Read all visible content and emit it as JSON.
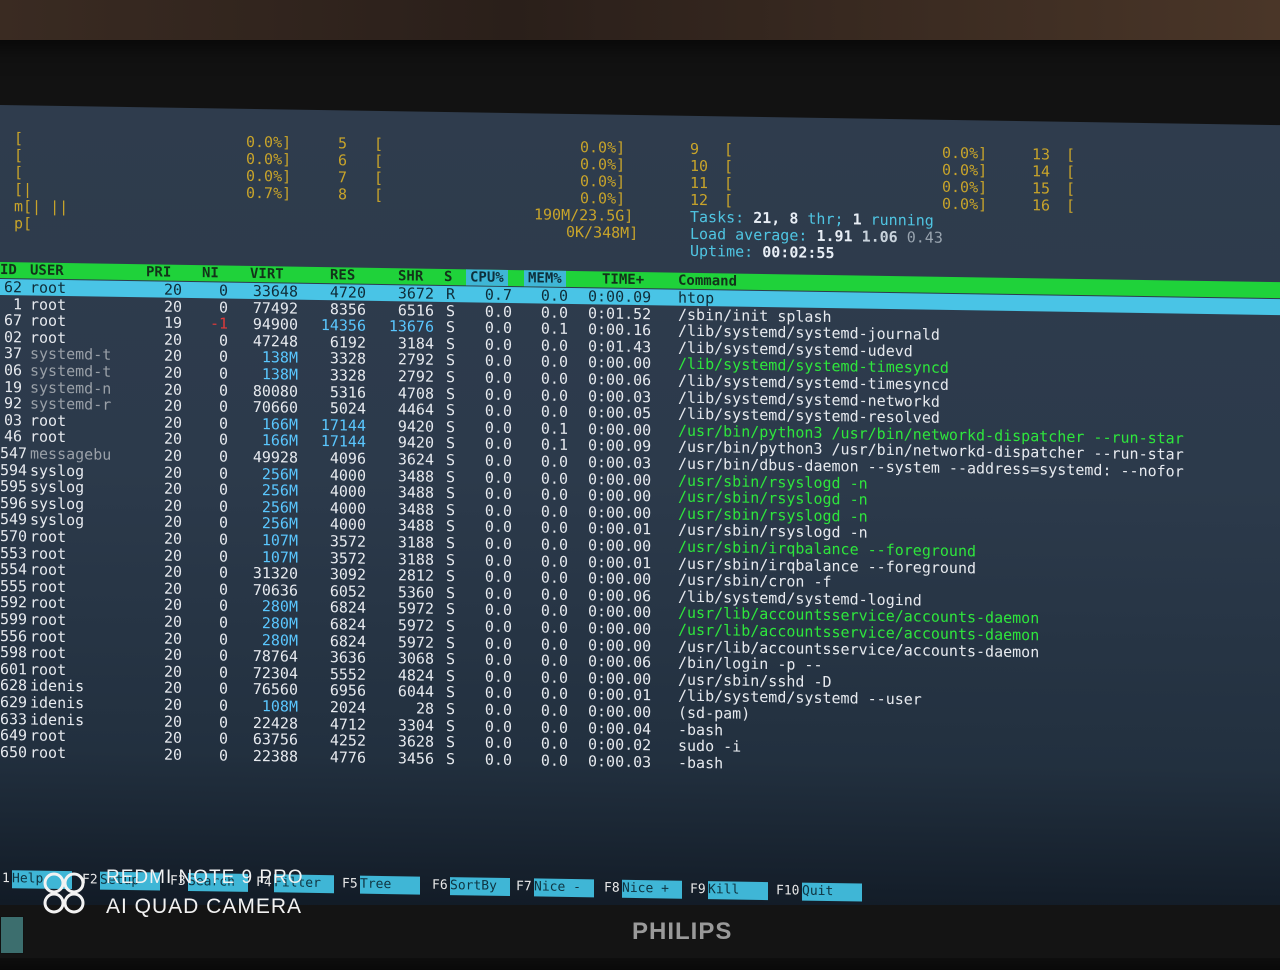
{
  "watermark": {
    "line1": "REDMI NOTE 9 PRO",
    "line2": "AI QUAD CAMERA"
  },
  "monitor_brand": "PHILIPS",
  "meters": {
    "col1": [
      "[",
      "[",
      "[",
      "[|",
      "m[| ||",
      "p["
    ],
    "col2": [
      "0.0%]",
      "0.0%]",
      "0.0%]",
      "0.7%]"
    ],
    "col3": [
      "5",
      "6",
      "7",
      "8"
    ],
    "col3b": [
      "[",
      "[",
      "[",
      "["
    ],
    "col4": [
      "0.0%]",
      "0.0%]",
      "0.0%]",
      "0.0%]",
      "190M/23.5G]",
      "0K/348M]"
    ],
    "col5": [
      "9",
      "10",
      "11",
      "12"
    ],
    "col5b": [
      "[",
      "[",
      "[",
      "["
    ],
    "col6": [
      "0.0%]",
      "0.0%]",
      "0.0%]",
      "0.0%]"
    ],
    "col7": [
      "13",
      "14",
      "15",
      "16"
    ],
    "col7b": [
      "[",
      "[",
      "[",
      "["
    ]
  },
  "stats": {
    "tasks_label": "Tasks:",
    "tasks_value": "21,",
    "thr_value": "8",
    "thr_label": "thr;",
    "running_value": "1",
    "running_label": "running",
    "load_label": "Load average:",
    "load1": "1.91",
    "load5": "1.06",
    "load15": "0.43",
    "uptime_label": "Uptime:",
    "uptime_value": "00:02:55"
  },
  "columns": [
    "ID",
    "USER",
    "PRI",
    "NI",
    "VIRT",
    "RES",
    "SHR",
    "S",
    "CPU%",
    "MEM%",
    "TIME+",
    "Command"
  ],
  "processes": [
    {
      "pid": "62",
      "user": "root",
      "pri": "20",
      "ni": "0",
      "virt": "33648",
      "res": "4720",
      "shr": "3672",
      "s": "R",
      "cpu": "0.7",
      "mem": "0.0",
      "time": "0:00.09",
      "cmd": "htop",
      "cmdc": "plain"
    },
    {
      "pid": "1",
      "user": "root",
      "pri": "20",
      "ni": "0",
      "virt": "77492",
      "res": "8356",
      "shr": "6516",
      "s": "S",
      "cpu": "0.0",
      "mem": "0.0",
      "time": "0:01.52",
      "cmd": "/sbin/init splash",
      "cmdc": "plain"
    },
    {
      "pid": "67",
      "user": "root",
      "pri": "19",
      "ni": "-1",
      "virt": "94900",
      "res": "14356",
      "shr": "13676",
      "s": "S",
      "cpu": "0.0",
      "mem": "0.1",
      "time": "0:00.16",
      "cmd": "/lib/systemd/systemd-journald",
      "cmdc": "plain"
    },
    {
      "pid": "02",
      "user": "root",
      "pri": "20",
      "ni": "0",
      "virt": "47248",
      "res": "6192",
      "shr": "3184",
      "s": "S",
      "cpu": "0.0",
      "mem": "0.0",
      "time": "0:01.43",
      "cmd": "/lib/systemd/systemd-udevd",
      "cmdc": "plain"
    },
    {
      "pid": "37",
      "user": "systemd-t",
      "pri": "20",
      "ni": "0",
      "virt": "138M",
      "res": "3328",
      "shr": "2792",
      "s": "S",
      "cpu": "0.0",
      "mem": "0.0",
      "time": "0:00.00",
      "cmd": "/lib/systemd/systemd-timesyncd",
      "cmdc": "green"
    },
    {
      "pid": "06",
      "user": "systemd-t",
      "pri": "20",
      "ni": "0",
      "virt": "138M",
      "res": "3328",
      "shr": "2792",
      "s": "S",
      "cpu": "0.0",
      "mem": "0.0",
      "time": "0:00.06",
      "cmd": "/lib/systemd/systemd-timesyncd",
      "cmdc": "plain"
    },
    {
      "pid": "19",
      "user": "systemd-n",
      "pri": "20",
      "ni": "0",
      "virt": "80080",
      "res": "5316",
      "shr": "4708",
      "s": "S",
      "cpu": "0.0",
      "mem": "0.0",
      "time": "0:00.03",
      "cmd": "/lib/systemd/systemd-networkd",
      "cmdc": "plain"
    },
    {
      "pid": "92",
      "user": "systemd-r",
      "pri": "20",
      "ni": "0",
      "virt": "70660",
      "res": "5024",
      "shr": "4464",
      "s": "S",
      "cpu": "0.0",
      "mem": "0.0",
      "time": "0:00.05",
      "cmd": "/lib/systemd/systemd-resolved",
      "cmdc": "plain"
    },
    {
      "pid": "03",
      "user": "root",
      "pri": "20",
      "ni": "0",
      "virt": "166M",
      "res": "17144",
      "shr": "9420",
      "s": "S",
      "cpu": "0.0",
      "mem": "0.1",
      "time": "0:00.00",
      "cmd": "/usr/bin/python3 /usr/bin/networkd-dispatcher --run-star",
      "cmdc": "green"
    },
    {
      "pid": "46",
      "user": "root",
      "pri": "20",
      "ni": "0",
      "virt": "166M",
      "res": "17144",
      "shr": "9420",
      "s": "S",
      "cpu": "0.0",
      "mem": "0.1",
      "time": "0:00.09",
      "cmd": "/usr/bin/python3 /usr/bin/networkd-dispatcher --run-star",
      "cmdc": "plain"
    },
    {
      "pid": "547",
      "user": "messagebu",
      "pri": "20",
      "ni": "0",
      "virt": "49928",
      "res": "4096",
      "shr": "3624",
      "s": "S",
      "cpu": "0.0",
      "mem": "0.0",
      "time": "0:00.03",
      "cmd": "/usr/bin/dbus-daemon --system --address=systemd: --nofor",
      "cmdc": "plain"
    },
    {
      "pid": "594",
      "user": "syslog",
      "pri": "20",
      "ni": "0",
      "virt": "256M",
      "res": "4000",
      "shr": "3488",
      "s": "S",
      "cpu": "0.0",
      "mem": "0.0",
      "time": "0:00.00",
      "cmd": "/usr/sbin/rsyslogd -n",
      "cmdc": "green"
    },
    {
      "pid": "595",
      "user": "syslog",
      "pri": "20",
      "ni": "0",
      "virt": "256M",
      "res": "4000",
      "shr": "3488",
      "s": "S",
      "cpu": "0.0",
      "mem": "0.0",
      "time": "0:00.00",
      "cmd": "/usr/sbin/rsyslogd -n",
      "cmdc": "green"
    },
    {
      "pid": "596",
      "user": "syslog",
      "pri": "20",
      "ni": "0",
      "virt": "256M",
      "res": "4000",
      "shr": "3488",
      "s": "S",
      "cpu": "0.0",
      "mem": "0.0",
      "time": "0:00.00",
      "cmd": "/usr/sbin/rsyslogd -n",
      "cmdc": "green"
    },
    {
      "pid": "549",
      "user": "syslog",
      "pri": "20",
      "ni": "0",
      "virt": "256M",
      "res": "4000",
      "shr": "3488",
      "s": "S",
      "cpu": "0.0",
      "mem": "0.0",
      "time": "0:00.01",
      "cmd": "/usr/sbin/rsyslogd -n",
      "cmdc": "plain"
    },
    {
      "pid": "570",
      "user": "root",
      "pri": "20",
      "ni": "0",
      "virt": "107M",
      "res": "3572",
      "shr": "3188",
      "s": "S",
      "cpu": "0.0",
      "mem": "0.0",
      "time": "0:00.00",
      "cmd": "/usr/sbin/irqbalance --foreground",
      "cmdc": "green"
    },
    {
      "pid": "553",
      "user": "root",
      "pri": "20",
      "ni": "0",
      "virt": "107M",
      "res": "3572",
      "shr": "3188",
      "s": "S",
      "cpu": "0.0",
      "mem": "0.0",
      "time": "0:00.01",
      "cmd": "/usr/sbin/irqbalance --foreground",
      "cmdc": "plain"
    },
    {
      "pid": "554",
      "user": "root",
      "pri": "20",
      "ni": "0",
      "virt": "31320",
      "res": "3092",
      "shr": "2812",
      "s": "S",
      "cpu": "0.0",
      "mem": "0.0",
      "time": "0:00.00",
      "cmd": "/usr/sbin/cron -f",
      "cmdc": "plain"
    },
    {
      "pid": "555",
      "user": "root",
      "pri": "20",
      "ni": "0",
      "virt": "70636",
      "res": "6052",
      "shr": "5360",
      "s": "S",
      "cpu": "0.0",
      "mem": "0.0",
      "time": "0:00.06",
      "cmd": "/lib/systemd/systemd-logind",
      "cmdc": "plain"
    },
    {
      "pid": "592",
      "user": "root",
      "pri": "20",
      "ni": "0",
      "virt": "280M",
      "res": "6824",
      "shr": "5972",
      "s": "S",
      "cpu": "0.0",
      "mem": "0.0",
      "time": "0:00.00",
      "cmd": "/usr/lib/accountsservice/accounts-daemon",
      "cmdc": "green"
    },
    {
      "pid": "599",
      "user": "root",
      "pri": "20",
      "ni": "0",
      "virt": "280M",
      "res": "6824",
      "shr": "5972",
      "s": "S",
      "cpu": "0.0",
      "mem": "0.0",
      "time": "0:00.00",
      "cmd": "/usr/lib/accountsservice/accounts-daemon",
      "cmdc": "green"
    },
    {
      "pid": "556",
      "user": "root",
      "pri": "20",
      "ni": "0",
      "virt": "280M",
      "res": "6824",
      "shr": "5972",
      "s": "S",
      "cpu": "0.0",
      "mem": "0.0",
      "time": "0:00.00",
      "cmd": "/usr/lib/accountsservice/accounts-daemon",
      "cmdc": "plain"
    },
    {
      "pid": "598",
      "user": "root",
      "pri": "20",
      "ni": "0",
      "virt": "78764",
      "res": "3636",
      "shr": "3068",
      "s": "S",
      "cpu": "0.0",
      "mem": "0.0",
      "time": "0:00.06",
      "cmd": "/bin/login -p --",
      "cmdc": "plain"
    },
    {
      "pid": "601",
      "user": "root",
      "pri": "20",
      "ni": "0",
      "virt": "72304",
      "res": "5552",
      "shr": "4824",
      "s": "S",
      "cpu": "0.0",
      "mem": "0.0",
      "time": "0:00.00",
      "cmd": "/usr/sbin/sshd -D",
      "cmdc": "plain"
    },
    {
      "pid": "628",
      "user": "idenis",
      "pri": "20",
      "ni": "0",
      "virt": "76560",
      "res": "6956",
      "shr": "6044",
      "s": "S",
      "cpu": "0.0",
      "mem": "0.0",
      "time": "0:00.01",
      "cmd": "/lib/systemd/systemd --user",
      "cmdc": "plain"
    },
    {
      "pid": "629",
      "user": "idenis",
      "pri": "20",
      "ni": "0",
      "virt": "108M",
      "res": "2024",
      "shr": "28",
      "s": "S",
      "cpu": "0.0",
      "mem": "0.0",
      "time": "0:00.00",
      "cmd": "(sd-pam)",
      "cmdc": "plain"
    },
    {
      "pid": "633",
      "user": "idenis",
      "pri": "20",
      "ni": "0",
      "virt": "22428",
      "res": "4712",
      "shr": "3304",
      "s": "S",
      "cpu": "0.0",
      "mem": "0.0",
      "time": "0:00.04",
      "cmd": "-bash",
      "cmdc": "plain"
    },
    {
      "pid": "649",
      "user": "root",
      "pri": "20",
      "ni": "0",
      "virt": "63756",
      "res": "4252",
      "shr": "3628",
      "s": "S",
      "cpu": "0.0",
      "mem": "0.0",
      "time": "0:00.02",
      "cmd": "sudo -i",
      "cmdc": "plain"
    },
    {
      "pid": "650",
      "user": "root",
      "pri": "20",
      "ni": "0",
      "virt": "22388",
      "res": "4776",
      "shr": "3456",
      "s": "S",
      "cpu": "0.0",
      "mem": "0.0",
      "time": "0:00.03",
      "cmd": "-bash",
      "cmdc": "plain"
    }
  ],
  "function_keys": [
    {
      "key": "1",
      "label": "Help"
    },
    {
      "key": "F2",
      "label": "Setup"
    },
    {
      "key": "F3",
      "label": "Search"
    },
    {
      "key": "F4",
      "label": "Filter"
    },
    {
      "key": "F5",
      "label": "Tree"
    },
    {
      "key": "F6",
      "label": "SortBy"
    },
    {
      "key": "F7",
      "label": "Nice -"
    },
    {
      "key": "F8",
      "label": "Nice +"
    },
    {
      "key": "F9",
      "label": "Kill"
    },
    {
      "key": "F10",
      "label": "Quit"
    }
  ],
  "colors": {
    "header_bg": "#1fd23a",
    "selected_bg": "#49c4e6",
    "green_text": "#2ee63c",
    "cyan_text": "#4fc5e2"
  }
}
